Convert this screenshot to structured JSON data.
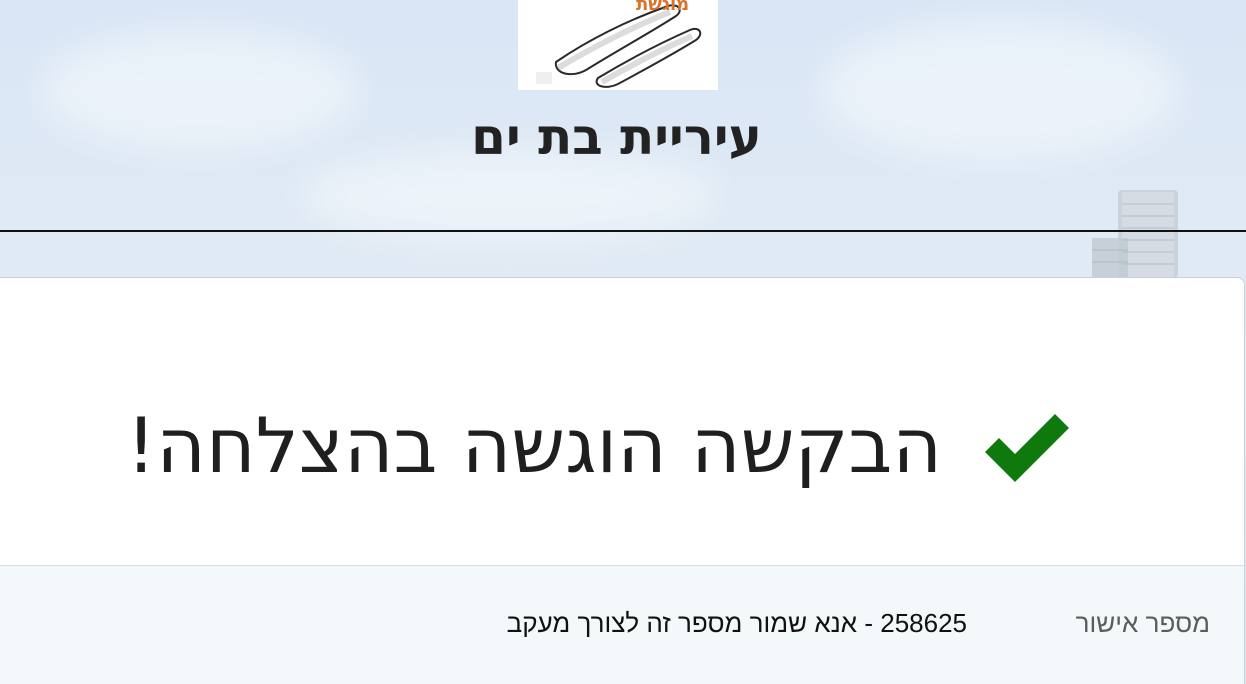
{
  "header": {
    "city_name": "עיריית בת ים",
    "logo_text": "מוגשת"
  },
  "result": {
    "success_message": "הבקשה הוגשה בהצלחה!"
  },
  "details": {
    "approval_label": "מספר אישור",
    "approval_value": "258625 - אנא שמור מספר זה לצורך מעקב"
  },
  "colors": {
    "success_check": "#0e7a0e",
    "title_text": "#222222",
    "details_background": "#f3f8fa"
  },
  "icons": {
    "success": "checkmark-icon"
  }
}
